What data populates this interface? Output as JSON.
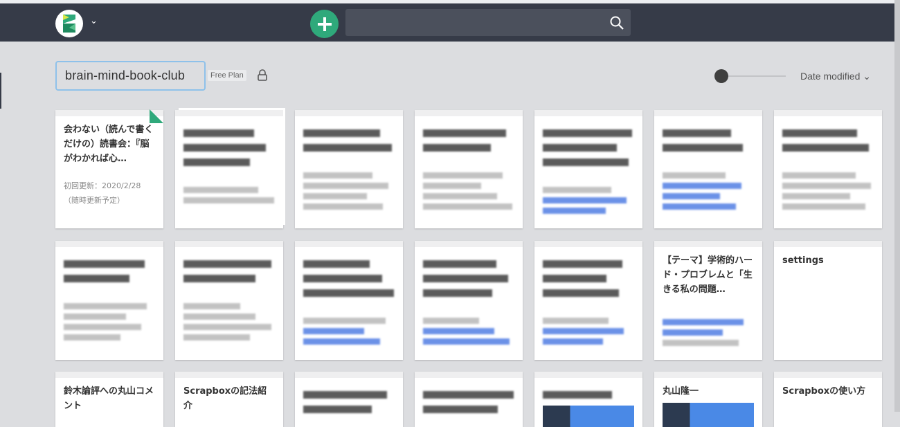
{
  "navbar": {
    "search_placeholder": "",
    "search_value": ""
  },
  "project": {
    "name": "brain-mind-book-club",
    "plan": "Free Plan"
  },
  "sort": {
    "label": "Date modified",
    "slider_value": 0
  },
  "cards": [
    {
      "title": "会わない（読んで書くだけの）読書会：『脳がわかれば心…",
      "desc": "初回更新：2020/2/28（随時更新予定）",
      "pinned": true
    },
    {
      "blur": [
        "t",
        "t",
        "t",
        "g",
        "g"
      ],
      "stack": true
    },
    {
      "blur": [
        "t",
        "t",
        "g",
        "g",
        "g",
        "g"
      ]
    },
    {
      "blur": [
        "t",
        "t",
        "g",
        "g",
        "g",
        "g"
      ]
    },
    {
      "blur": [
        "t",
        "t",
        "t",
        "g",
        "b",
        "b"
      ]
    },
    {
      "blur": [
        "t",
        "t",
        "g",
        "b",
        "b",
        "b"
      ]
    },
    {
      "blur": [
        "t",
        "t",
        "g",
        "g",
        "g",
        "g"
      ]
    },
    {
      "blur": [
        "t",
        "t",
        "g",
        "g",
        "g",
        "g"
      ]
    },
    {
      "blur": [
        "t",
        "t",
        "g",
        "g",
        "g",
        "g"
      ]
    },
    {
      "blur": [
        "t",
        "t",
        "t",
        "g",
        "b",
        "b"
      ]
    },
    {
      "blur": [
        "t",
        "t",
        "t",
        "g",
        "b",
        "b"
      ]
    },
    {
      "blur": [
        "t",
        "t",
        "t",
        "g",
        "b",
        "b"
      ]
    },
    {
      "title": "【テーマ】学術的ハード・プロブレムと「生きる私の問題…",
      "blur_desc": [
        "b",
        "b",
        "g"
      ]
    },
    {
      "title": "settings"
    },
    {
      "title": "鈴木論評への丸山コメント"
    },
    {
      "title": "Scrapboxの記法紹介"
    },
    {
      "blur": [
        "t",
        "t"
      ]
    },
    {
      "blur": [
        "t",
        "t"
      ]
    },
    {
      "blur": [
        "t"
      ],
      "image": true
    },
    {
      "title": "丸山隆一",
      "image": true
    },
    {
      "title": "Scrapboxの使い方"
    }
  ]
}
